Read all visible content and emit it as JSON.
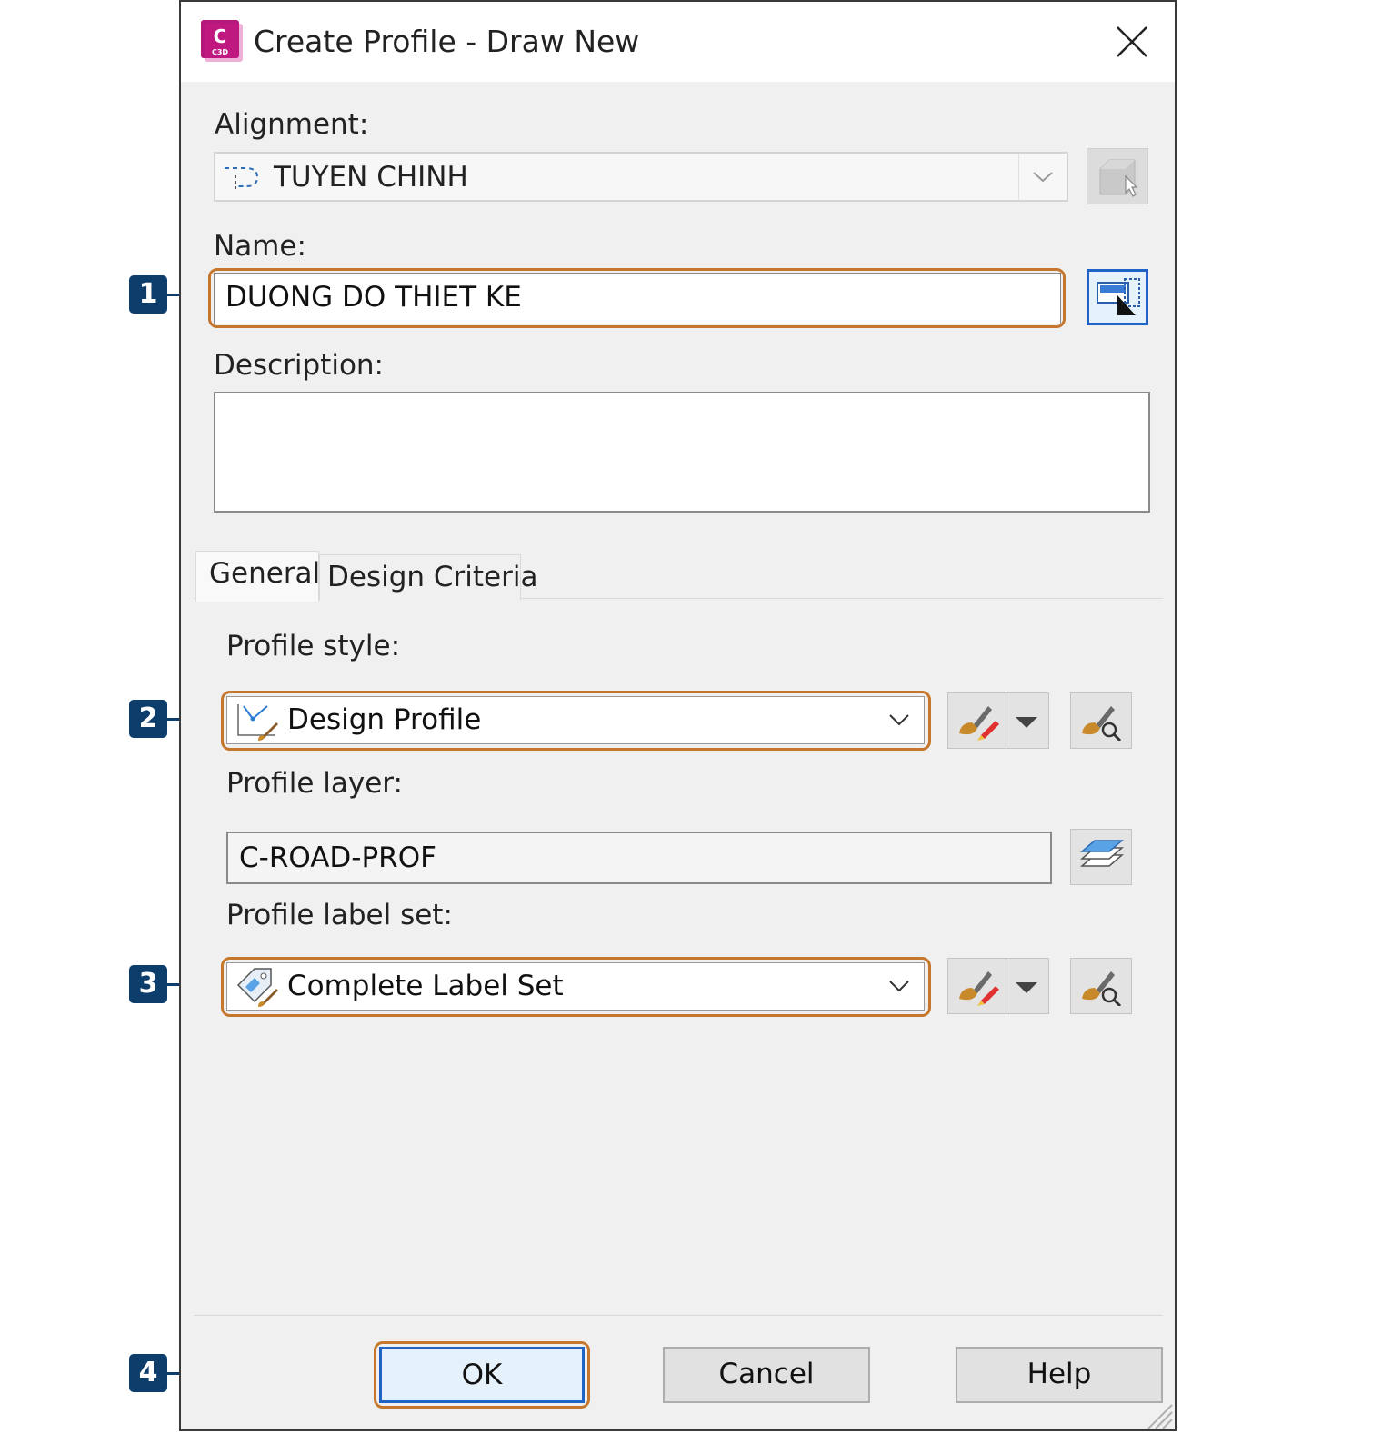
{
  "dialog": {
    "title": "Create Profile - Draw New",
    "app_icon_letter": "C",
    "app_icon_caption": "C3D",
    "app_icon_color": "#b6177a"
  },
  "alignment": {
    "label": "Alignment:",
    "value": "TUYEN CHINH"
  },
  "name": {
    "label": "Name:",
    "value": "DUONG DO THIET KE"
  },
  "description": {
    "label": "Description:",
    "value": ""
  },
  "tabs": [
    {
      "label": "General",
      "active": true
    },
    {
      "label": "Design Criteria",
      "active": false
    }
  ],
  "general": {
    "profile_style": {
      "label": "Profile style:",
      "value": "Design Profile"
    },
    "profile_layer": {
      "label": "Profile layer:",
      "value": "C-ROAD-PROF"
    },
    "profile_label_set": {
      "label": "Profile label set:",
      "value": "Complete Label Set"
    }
  },
  "buttons": {
    "ok": "OK",
    "cancel": "Cancel",
    "help": "Help"
  },
  "callouts": [
    "1",
    "2",
    "3",
    "4"
  ],
  "colors": {
    "highlight": "#c5782d",
    "callout": "#0c3d6b",
    "focus": "#1f63c6"
  }
}
